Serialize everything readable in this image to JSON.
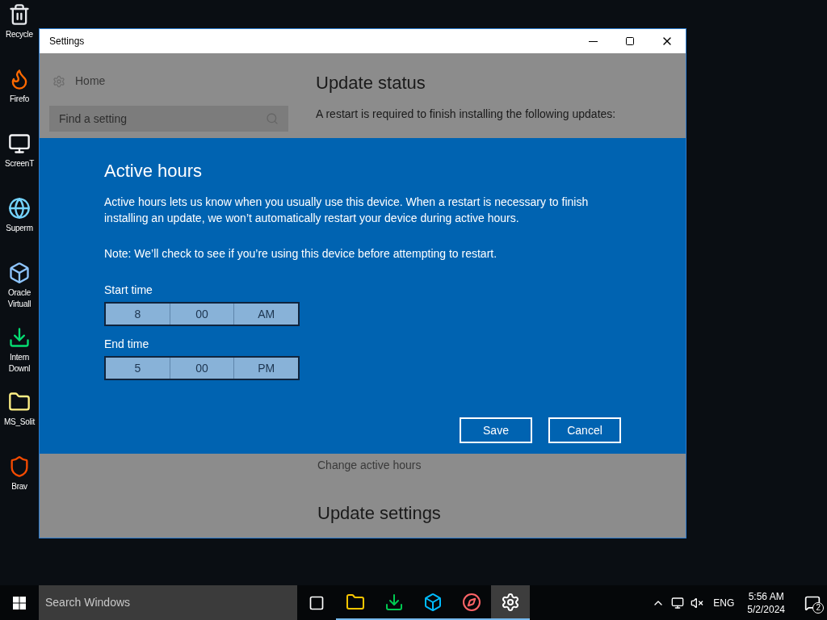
{
  "desktop_icons": [
    {
      "kind": "recycle",
      "label": "Recycle"
    },
    {
      "kind": "firefox",
      "label": "Firefo"
    },
    {
      "kind": "monitor",
      "label": "ScreenT"
    },
    {
      "kind": "globe",
      "label": "Superm"
    },
    {
      "kind": "box",
      "label": "Oracle Virtuall"
    },
    {
      "kind": "download",
      "label": "Intern Downl"
    },
    {
      "kind": "folder",
      "label": "MS_Solit"
    },
    {
      "kind": "lion",
      "label": "Brav"
    }
  ],
  "window": {
    "title": "Settings",
    "sidebar": {
      "home": "Home",
      "search": {
        "placeholder": "Find a setting"
      }
    },
    "content": {
      "heading": "Update status",
      "text": "A restart is required to finish installing the following updates:",
      "link": "Change active hours",
      "heading2": "Update settings"
    }
  },
  "dialog": {
    "title": "Active hours",
    "description": "Active hours lets us know when you usually use this device. When a restart is necessary to finish installing an update, we won’t automatically restart your device during active hours.",
    "note": "Note: We’ll check to see if you’re using this device before attempting to restart.",
    "pickers": [
      {
        "label": "Start time",
        "hour": "8",
        "minute": "00",
        "period": "AM"
      },
      {
        "label": "End time",
        "hour": "5",
        "minute": "00",
        "period": "PM"
      }
    ],
    "buttons": [
      "Save",
      "Cancel"
    ]
  },
  "taskbar": {
    "search": {
      "placeholder": "Search Windows"
    },
    "apps": [
      {
        "kind": "folder",
        "selected": false
      },
      {
        "kind": "download",
        "selected": false
      },
      {
        "kind": "xp",
        "selected": false
      },
      {
        "kind": "compass",
        "selected": false
      },
      {
        "kind": "gear",
        "selected": true
      }
    ],
    "language": "ENG",
    "time": "5:56 AM",
    "date": "5/2/2024",
    "notifications": "2"
  }
}
